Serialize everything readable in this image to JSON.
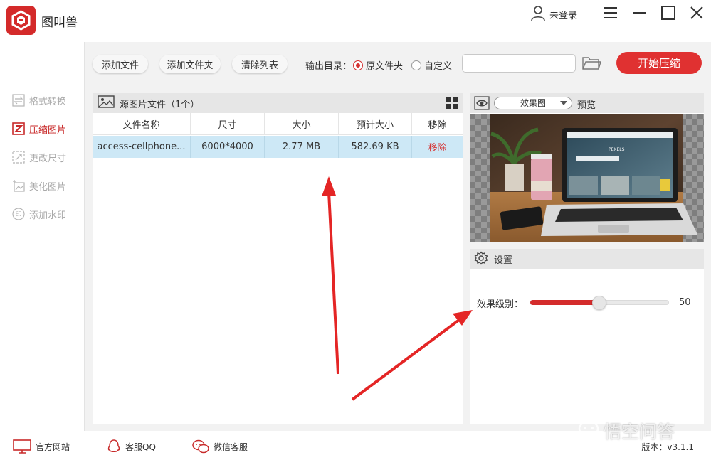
{
  "app": {
    "title": "图叫兽"
  },
  "header": {
    "user_label": "未登录"
  },
  "sidebar": {
    "items": [
      {
        "label": "格式转换",
        "icon": "convert-icon",
        "active": false
      },
      {
        "label": "压缩图片",
        "icon": "compress-icon",
        "active": true
      },
      {
        "label": "更改尺寸",
        "icon": "resize-icon",
        "active": false
      },
      {
        "label": "美化图片",
        "icon": "beautify-icon",
        "active": false
      },
      {
        "label": "添加水印",
        "icon": "watermark-icon",
        "active": false
      }
    ]
  },
  "toolbar": {
    "add_file": "添加文件",
    "add_folder": "添加文件夹",
    "clear_list": "清除列表",
    "output_label": "输出目录：",
    "option_original": "原文件夹",
    "option_custom": "自定义",
    "path_value": "",
    "start": "开始压缩"
  },
  "file_panel": {
    "title": "源图片文件（1个）",
    "columns": [
      "文件名称",
      "尺寸",
      "大小",
      "预计大小",
      "移除"
    ],
    "rows": [
      {
        "name": "access-cellphone...",
        "dimensions": "6000*4000",
        "size": "2.77 MB",
        "estimated": "582.69 KB",
        "remove": "移除"
      }
    ]
  },
  "preview": {
    "select_value": "效果图",
    "label": "预览",
    "image_text": "PEXELS"
  },
  "settings": {
    "title": "设置",
    "level_label": "效果级别：",
    "level_value": "50",
    "level_fraction": 0.5
  },
  "footer": {
    "website": "官方网站",
    "qq": "客服QQ",
    "wechat": "微信客服",
    "version": "版本：v3.1.1",
    "watermark": "悟空问答"
  },
  "colors": {
    "accent": "#e03131",
    "active_nav": "#c82a2a",
    "selected_row": "#cde8f6"
  }
}
